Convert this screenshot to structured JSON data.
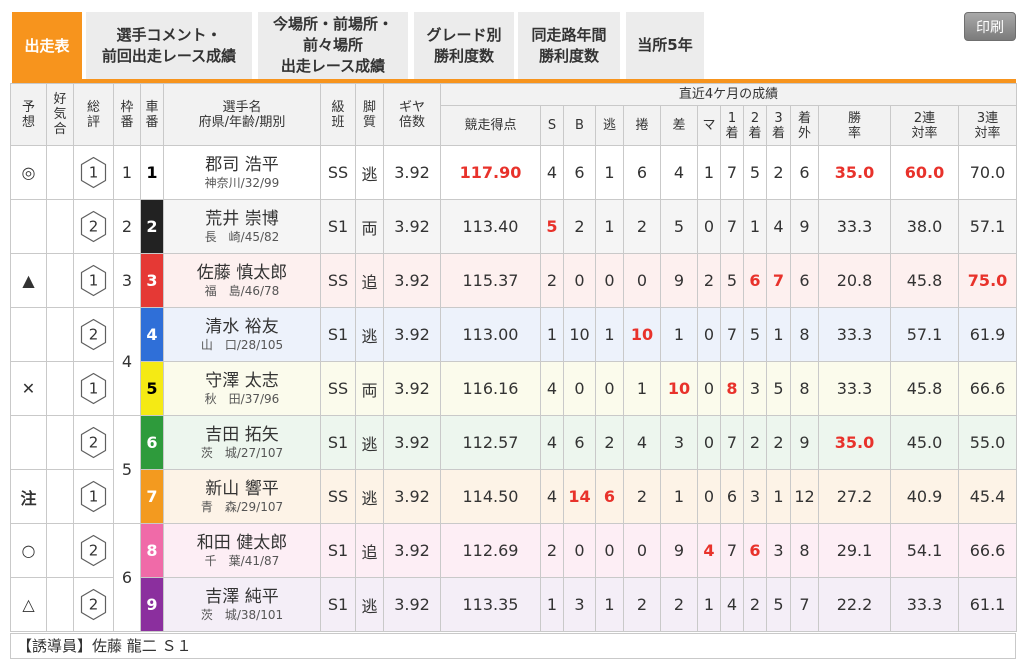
{
  "tabs": [
    {
      "label": "出走表",
      "active": true
    },
    {
      "label": "選手コメント・\n前回出走レース成績",
      "active": false
    },
    {
      "label": "今場所・前場所・\n前々場所\n出走レース成績",
      "active": false
    },
    {
      "label": "グレード別\n勝利度数",
      "active": false
    },
    {
      "label": "同走路年間\n勝利度数",
      "active": false
    },
    {
      "label": "当所5年",
      "active": false
    }
  ],
  "print_button": {
    "label": "印刷"
  },
  "colors": {
    "accent": "#f7941d",
    "emphasis": "#e8322b"
  },
  "car_colors": {
    "1": {
      "bg": "#ffffff",
      "fg": "#000000",
      "tint": "#ffffff"
    },
    "2": {
      "bg": "#222222",
      "fg": "#ffffff",
      "tint": "#f5f5f5"
    },
    "3": {
      "bg": "#e53935",
      "fg": "#ffffff",
      "tint": "#fdf0ef"
    },
    "4": {
      "bg": "#2f6fd8",
      "fg": "#ffffff",
      "tint": "#edf2fb"
    },
    "5": {
      "bg": "#f5ea14",
      "fg": "#000000",
      "tint": "#fbfbec"
    },
    "6": {
      "bg": "#2e9b3c",
      "fg": "#ffffff",
      "tint": "#edf6ee"
    },
    "7": {
      "bg": "#f39a1f",
      "fg": "#ffffff",
      "tint": "#fdf3e7"
    },
    "8": {
      "bg": "#f06aa8",
      "fg": "#ffffff",
      "tint": "#fdeef5"
    },
    "9": {
      "bg": "#8b2f9e",
      "fg": "#ffffff",
      "tint": "#f4eef7"
    }
  },
  "table": {
    "header": {
      "mark": "予\n想",
      "kiai": "好\n気\n合",
      "rating": "総\n評",
      "waku": "枠\n番",
      "car": "車\n番",
      "name": "選手名\n府県/年齢/期別",
      "class": "級\n班",
      "style": "脚\n質",
      "gear": "ギヤ\n倍数",
      "period": "直近4ケ月の成績",
      "score": "競走得点",
      "s": "S",
      "b": "B",
      "nige": "逃",
      "makuri": "捲",
      "sashi": "差",
      "mark_count": "マ",
      "first": "1\n着",
      "second": "2\n着",
      "third": "3\n着",
      "out": "着\n外",
      "win_rate": "勝\n率",
      "quinella_rate": "2連\n対率",
      "trio_rate": "3連\n対率"
    },
    "rows": [
      {
        "mark": "◎",
        "rating": "1",
        "waku": "1",
        "car": "1",
        "name": "郡司 浩平",
        "profile": "神奈川/32/99",
        "class": "SS",
        "style": "逃",
        "gear": "3.92",
        "score": "117.90",
        "s": "4",
        "b": "6",
        "nige": "1",
        "makuri": "6",
        "sashi": "4",
        "mark_count": "1",
        "first": "7",
        "second": "5",
        "third": "2",
        "out": "6",
        "win_rate": "35.0",
        "quinella_rate": "60.0",
        "trio_rate": "70.0",
        "emphasis": {
          "score": true,
          "win_rate": true,
          "quinella_rate": true
        }
      },
      {
        "rating": "2",
        "waku": "2",
        "car": "2",
        "name": "荒井 崇博",
        "profile": "長　崎/45/82",
        "class": "S1",
        "style": "両",
        "gear": "3.92",
        "score": "113.40",
        "s": "5",
        "b": "2",
        "nige": "1",
        "makuri": "2",
        "sashi": "5",
        "mark_count": "0",
        "first": "7",
        "second": "1",
        "third": "4",
        "out": "9",
        "win_rate": "33.3",
        "quinella_rate": "38.0",
        "trio_rate": "57.1",
        "emphasis": {
          "s": true
        }
      },
      {
        "mark": "▲",
        "rating": "1",
        "waku": "3",
        "car": "3",
        "name": "佐藤 慎太郎",
        "profile": "福　島/46/78",
        "class": "SS",
        "style": "追",
        "gear": "3.92",
        "score": "115.37",
        "s": "2",
        "b": "0",
        "nige": "0",
        "makuri": "0",
        "sashi": "9",
        "mark_count": "2",
        "first": "5",
        "second": "6",
        "third": "7",
        "out": "6",
        "win_rate": "20.8",
        "quinella_rate": "45.8",
        "trio_rate": "75.0",
        "emphasis": {
          "second": true,
          "third": true,
          "trio_rate": true
        }
      },
      {
        "rating": "2",
        "waku": "4",
        "car": "4",
        "name": "清水 裕友",
        "profile": "山　口/28/105",
        "class": "S1",
        "style": "逃",
        "gear": "3.92",
        "score": "113.00",
        "s": "1",
        "b": "10",
        "nige": "1",
        "makuri": "10",
        "sashi": "1",
        "mark_count": "0",
        "first": "7",
        "second": "5",
        "third": "1",
        "out": "8",
        "win_rate": "33.3",
        "quinella_rate": "57.1",
        "trio_rate": "61.9",
        "emphasis": {
          "makuri": true
        }
      },
      {
        "mark": "✕",
        "rating": "1",
        "car": "5",
        "name": "守澤 太志",
        "profile": "秋　田/37/96",
        "class": "SS",
        "style": "両",
        "gear": "3.92",
        "score": "116.16",
        "s": "4",
        "b": "0",
        "nige": "0",
        "makuri": "1",
        "sashi": "10",
        "mark_count": "0",
        "first": "8",
        "second": "3",
        "third": "5",
        "out": "8",
        "win_rate": "33.3",
        "quinella_rate": "45.8",
        "trio_rate": "66.6",
        "emphasis": {
          "sashi": true,
          "first": true
        }
      },
      {
        "rating": "2",
        "waku": "5",
        "car": "6",
        "name": "吉田 拓矢",
        "profile": "茨　城/27/107",
        "class": "S1",
        "style": "逃",
        "gear": "3.92",
        "score": "112.57",
        "s": "4",
        "b": "6",
        "nige": "2",
        "makuri": "4",
        "sashi": "3",
        "mark_count": "0",
        "first": "7",
        "second": "2",
        "third": "2",
        "out": "9",
        "win_rate": "35.0",
        "quinella_rate": "45.0",
        "trio_rate": "55.0",
        "emphasis": {
          "win_rate": true
        }
      },
      {
        "mark": "注",
        "rating": "1",
        "car": "7",
        "name": "新山 響平",
        "profile": "青　森/29/107",
        "class": "SS",
        "style": "逃",
        "gear": "3.92",
        "score": "114.50",
        "s": "4",
        "b": "14",
        "nige": "6",
        "makuri": "2",
        "sashi": "1",
        "mark_count": "0",
        "first": "6",
        "second": "3",
        "third": "1",
        "out": "12",
        "win_rate": "27.2",
        "quinella_rate": "40.9",
        "trio_rate": "45.4",
        "emphasis": {
          "b": true,
          "nige": true
        }
      },
      {
        "mark": "○",
        "rating": "2",
        "waku": "6",
        "car": "8",
        "name": "和田 健太郎",
        "profile": "千　葉/41/87",
        "class": "S1",
        "style": "追",
        "gear": "3.92",
        "score": "112.69",
        "s": "2",
        "b": "0",
        "nige": "0",
        "makuri": "0",
        "sashi": "9",
        "mark_count": "4",
        "first": "7",
        "second": "6",
        "third": "3",
        "out": "8",
        "win_rate": "29.1",
        "quinella_rate": "54.1",
        "trio_rate": "66.6",
        "emphasis": {
          "mark_count": true,
          "second": true
        }
      },
      {
        "mark": "△",
        "rating": "2",
        "car": "9",
        "name": "吉澤 純平",
        "profile": "茨　城/38/101",
        "class": "S1",
        "style": "逃",
        "gear": "3.92",
        "score": "113.35",
        "s": "1",
        "b": "3",
        "nige": "1",
        "makuri": "2",
        "sashi": "2",
        "mark_count": "1",
        "first": "4",
        "second": "2",
        "third": "5",
        "out": "7",
        "win_rate": "22.2",
        "quinella_rate": "33.3",
        "trio_rate": "61.1",
        "emphasis": {}
      }
    ]
  },
  "footer": {
    "guide_rider": "【誘導員】佐藤 龍二 Ｓ１"
  }
}
